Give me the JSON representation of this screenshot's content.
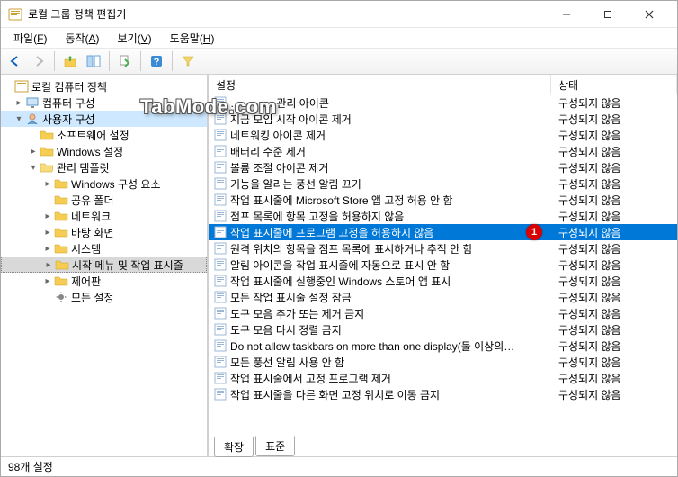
{
  "window": {
    "title": "로컬 그룹 정책 편집기"
  },
  "menubar": [
    {
      "label": "파일",
      "hotkey": "F"
    },
    {
      "label": "동작",
      "hotkey": "A"
    },
    {
      "label": "보기",
      "hotkey": "V"
    },
    {
      "label": "도움말",
      "hotkey": "H"
    }
  ],
  "tree": {
    "root": {
      "label": "로컬 컴퓨터 정책"
    },
    "computer": {
      "label": "컴퓨터 구성"
    },
    "user": {
      "label": "사용자 구성"
    },
    "user_children": [
      {
        "label": "소프트웨어 설정",
        "expandable": false
      },
      {
        "label": "Windows 설정",
        "expandable": true
      }
    ],
    "admin_templates": {
      "label": "관리 템플릿"
    },
    "admin_children_pre": [
      {
        "label": "Windows 구성 요소",
        "expandable": true
      },
      {
        "label": "공유 폴더",
        "expandable": false
      },
      {
        "label": "네트워크",
        "expandable": true
      },
      {
        "label": "바탕 화면",
        "expandable": true
      },
      {
        "label": "시스템",
        "expandable": true
      }
    ],
    "selected": {
      "label": "시작 메뉴 및 작업 표시줄"
    },
    "admin_children_post": [
      {
        "label": "제어판",
        "expandable": true
      },
      {
        "label": "모든 설정",
        "expandable": false,
        "icon": "gear"
      }
    ]
  },
  "list": {
    "header_setting": "설정",
    "header_state": "상태",
    "rows": [
      {
        "setting": "………… 관리 아이콘",
        "state": "구성되지 않음"
      },
      {
        "setting": "지금 모임 시작 아이콘 제거",
        "state": "구성되지 않음"
      },
      {
        "setting": "네트워킹 아이콘 제거",
        "state": "구성되지 않음"
      },
      {
        "setting": "배터리 수준 제거",
        "state": "구성되지 않음"
      },
      {
        "setting": "볼륨 조절 아이콘 제거",
        "state": "구성되지 않음"
      },
      {
        "setting": "기능을 알리는 풍선 알림 끄기",
        "state": "구성되지 않음"
      },
      {
        "setting": "작업 표시줄에 Microsoft Store 앱 고정 허용 안 함",
        "state": "구성되지 않음"
      },
      {
        "setting": "점프 목록에 항목 고정을 허용하지 않음",
        "state": "구성되지 않음"
      },
      {
        "setting": "작업 표시줄에 프로그램 고정을 허용하지 않음",
        "state": "구성되지 않음",
        "selected": true,
        "badge": "1"
      },
      {
        "setting": "원격 위치의 항목을 점프 목록에 표시하거나 추적 안 함",
        "state": "구성되지 않음"
      },
      {
        "setting": "알림 아이콘을 작업 표시줄에 자동으로 표시 안 함",
        "state": "구성되지 않음"
      },
      {
        "setting": "작업 표시줄에 실행중인 Windows 스토어 앱 표시",
        "state": "구성되지 않음"
      },
      {
        "setting": "모든 작업 표시줄 설정 잠금",
        "state": "구성되지 않음"
      },
      {
        "setting": "도구 모음 추가 또는 제거 금지",
        "state": "구성되지 않음"
      },
      {
        "setting": "도구 모음 다시 정렬 금지",
        "state": "구성되지 않음"
      },
      {
        "setting": "Do not allow taskbars on more than one display(둘 이상의…",
        "state": "구성되지 않음"
      },
      {
        "setting": "모든 풍선 알림 사용 안 함",
        "state": "구성되지 않음"
      },
      {
        "setting": "작업 표시줄에서 고정 프로그램 제거",
        "state": "구성되지 않음"
      },
      {
        "setting": "작업 표시줄을 다른 화면 고정 위치로 이동 금지",
        "state": "구성되지 않음"
      }
    ]
  },
  "tabs": [
    {
      "label": "확장",
      "active": false
    },
    {
      "label": "표준",
      "active": true
    }
  ],
  "statusbar": "98개 설정",
  "watermark": "TabMode.com"
}
